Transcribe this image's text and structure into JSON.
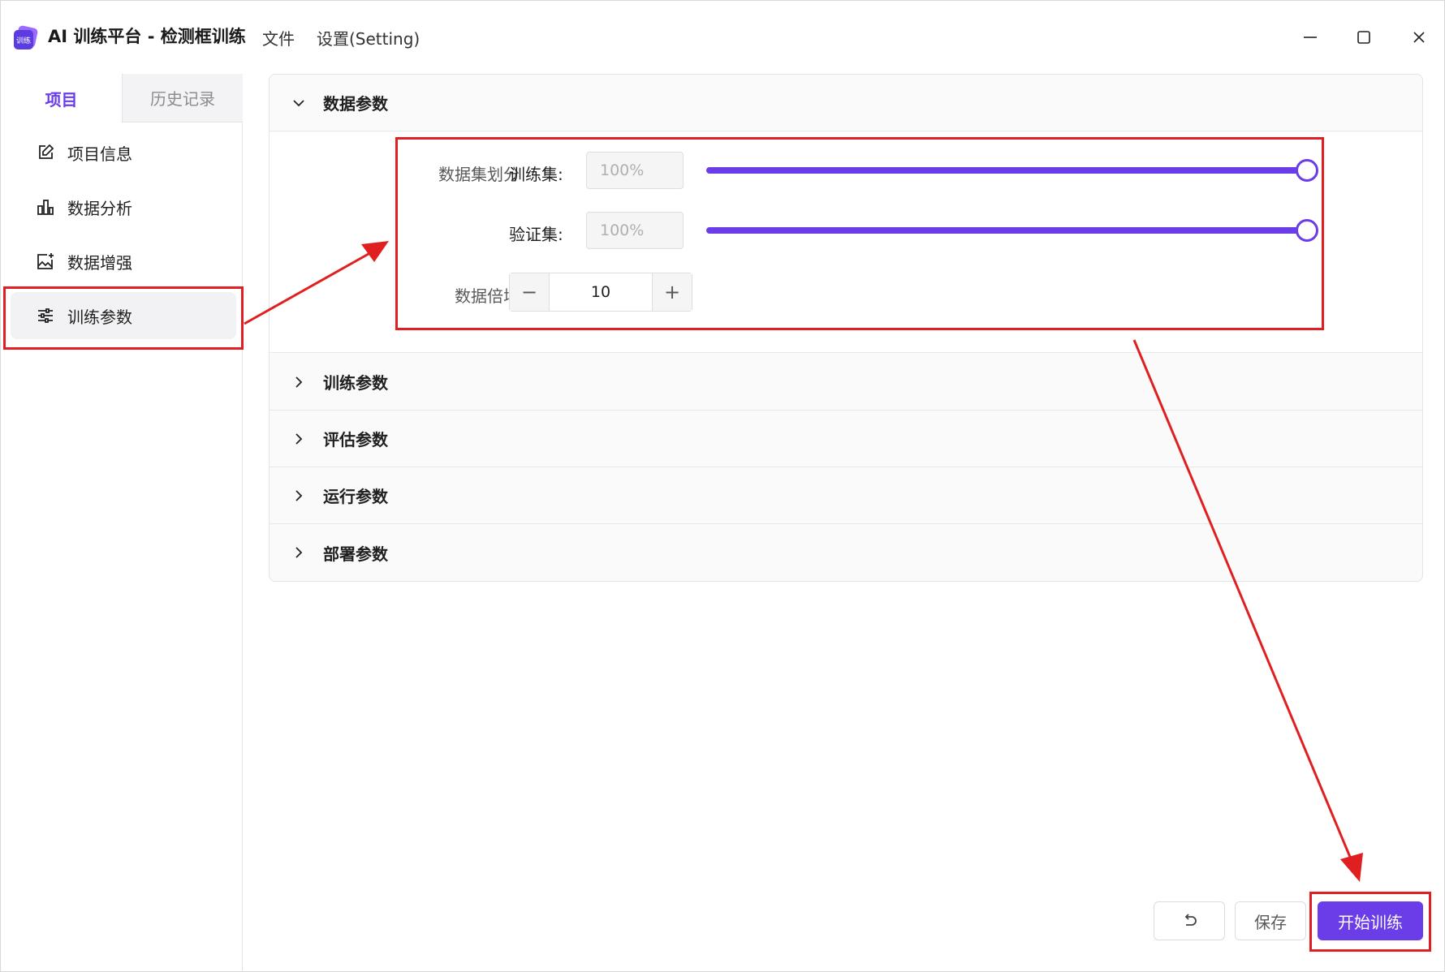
{
  "titlebar": {
    "logo_text": "训练",
    "title": "AI 训练平台 - 检测框训练",
    "menu": [
      "文件",
      "设置(Setting)"
    ]
  },
  "left_tabs": [
    {
      "label": "项目"
    },
    {
      "label": "历史记录"
    }
  ],
  "nav": [
    {
      "label": "项目信息",
      "icon": "edit-icon"
    },
    {
      "label": "数据分析",
      "icon": "bar-chart-icon"
    },
    {
      "label": "数据增强",
      "icon": "image-plus-icon"
    },
    {
      "label": "训练参数",
      "icon": "sliders-icon"
    }
  ],
  "sections": {
    "data": {
      "title": "数据参数",
      "expanded": true
    },
    "train": {
      "title": "训练参数"
    },
    "eval": {
      "title": "评估参数"
    },
    "run": {
      "title": "运行参数"
    },
    "deploy": {
      "title": "部署参数"
    }
  },
  "data_params": {
    "split_label": "数据集划分",
    "train_label": "训练集:",
    "train_value": "100%",
    "train_fraction": 1.0,
    "val_label": "验证集:",
    "val_value": "100%",
    "val_fraction": 1.0,
    "multiplier_label": "数据倍增",
    "multiplier_value": "10",
    "minus": "−",
    "plus": "+"
  },
  "buttons": {
    "save": "保存",
    "start": "开始训练"
  },
  "colors": {
    "accent": "#6a3de8",
    "annotation": "#e02020"
  }
}
